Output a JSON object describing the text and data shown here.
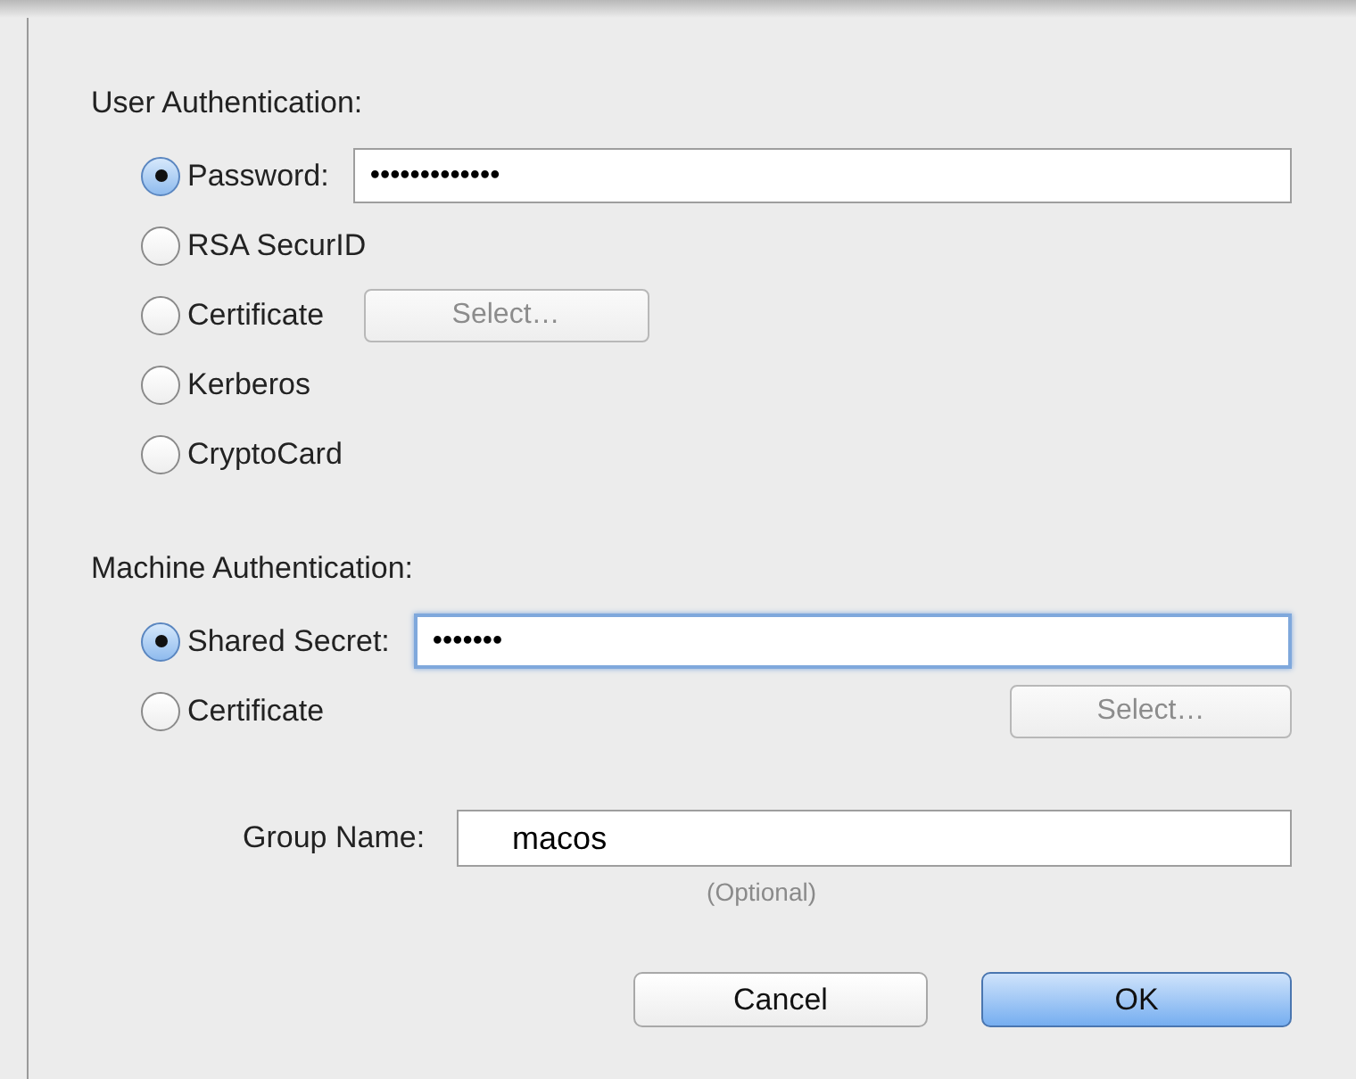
{
  "user_authentication": {
    "heading": "User Authentication:",
    "options": [
      {
        "label": "Password:",
        "selected": true,
        "kind": "field",
        "field": {
          "value": "•••••••••••••",
          "focused": false
        }
      },
      {
        "label": "RSA SecurID",
        "selected": false,
        "kind": "plain"
      },
      {
        "label": "Certificate",
        "selected": false,
        "kind": "button",
        "button": "Select…"
      },
      {
        "label": "Kerberos",
        "selected": false,
        "kind": "plain"
      },
      {
        "label": "CryptoCard",
        "selected": false,
        "kind": "plain"
      }
    ]
  },
  "machine_authentication": {
    "heading": "Machine Authentication:",
    "options": [
      {
        "label": "Shared Secret:",
        "selected": true,
        "kind": "field",
        "field": {
          "value": "•••••••",
          "focused": true
        }
      },
      {
        "label": "Certificate",
        "selected": false,
        "kind": "button_right",
        "button": "Select…"
      }
    ]
  },
  "group_name": {
    "label": "Group Name:",
    "value": "macos",
    "hint": "(Optional)"
  },
  "buttons": [
    {
      "label": "Cancel",
      "kind": "default"
    },
    {
      "label": "OK",
      "kind": "primary"
    }
  ]
}
